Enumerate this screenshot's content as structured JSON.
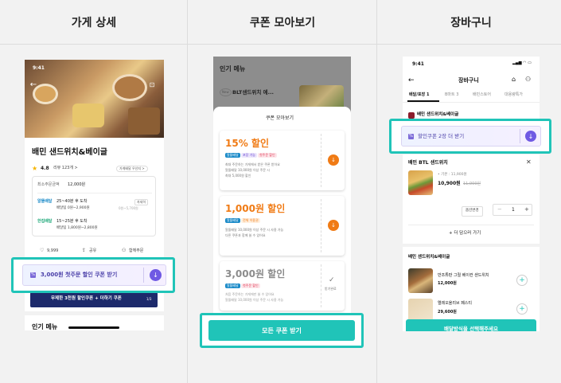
{
  "columns": [
    "가게 상세",
    "쿠폰 모아보기",
    "장바구니"
  ],
  "store": {
    "time": "9:41",
    "name": "배민 샌드위치&베이글",
    "rating": "4.8",
    "reviews": "리뷰 123개 >",
    "tag": "가게배달 우선지 >",
    "min_order_label": "최소주문금액",
    "min_order": "12,000원",
    "delivery1_label": "알뜰배달",
    "delivery1_time": "25~40분 후 도착",
    "delivery1_fee": "배달팁 0원~2,900원",
    "delivery1_extra": "0원~5,700원",
    "detail_btn": "자세히",
    "delivery2_label": "한집배달",
    "delivery2_time": "15~25분 후 도착",
    "delivery2_fee": "배달팁 1,800원~2,800원",
    "likes": "9,999",
    "share": "공유",
    "together": "함께주문",
    "coupon": "3,000원 첫주문 할인 쿠폰 받기",
    "banner": "무제한 3천원 할인쿠폰 + 더하기 쿠폰",
    "banner_page": "1/3",
    "popular_menu": "인기 메뉴"
  },
  "coupons": {
    "bg_title": "인기 메뉴",
    "bg_item": "BLT샌드위치 에...",
    "bg_badge": "New",
    "sheet_title": "쿠폰 모아보기",
    "items": [
      {
        "amount": "15% 할인",
        "tags": [
          "알뜰배달",
          "포장 가능",
          "첫주문 할인"
        ],
        "desc1": "최대 주문하는 가게에서 받은 쿠폰 받아요",
        "desc2": "알뜰배달 10,000원 이상 주문 시",
        "desc3": "최대 5,000원 할인",
        "color": "#f07b15"
      },
      {
        "amount": "1,000원 할인",
        "tags": [
          "알뜰배달",
          "전체 이용권"
        ],
        "desc1": "알뜰배달 10,000원 이상 주문 시 사용 가능",
        "desc2": "다른 쿠폰과 함께 쓸 수 있어요",
        "color": "#f07b15"
      },
      {
        "amount": "3,000원 할인",
        "tags": [
          "알뜰배달",
          "첫주문 할인"
        ],
        "desc1": "처음 주문하는 가게에만 쓸 수 있어요",
        "desc2": "알뜰배달 10,000원 이상 주문 시 사용 가능",
        "received": "받기완료",
        "color": "#8c8c8c"
      }
    ],
    "cta": "모든 쿠폰 받기"
  },
  "cart": {
    "time": "9:41",
    "title": "장바구니",
    "tabs": [
      "배달/포장 1",
      "B마트 3",
      "배민스토어",
      "대용량특가"
    ],
    "store_name": "배민 샌드위치&베이글",
    "coupon": "할인쿠폰 2장 더 받기",
    "item_name": "배민 BTL 샌드위치",
    "item_opt": "• 기본 : 11,900원",
    "item_price": "10,900원",
    "item_orig": "11,900원",
    "option_btn": "옵션변경",
    "qty": "1",
    "add_more": "+ 더 담으러 가기",
    "rec_store": "배민 샌드위치&베이글",
    "rec1_name": "반조튜판 그릴 베이컨 샌드위치",
    "rec1_price": "12,000원",
    "rec2_name": "엘레오올리브 페스티",
    "rec2_price": "29,600원",
    "cta": "배달방식을 선택해주세요",
    "accent": "#20c4b8"
  }
}
